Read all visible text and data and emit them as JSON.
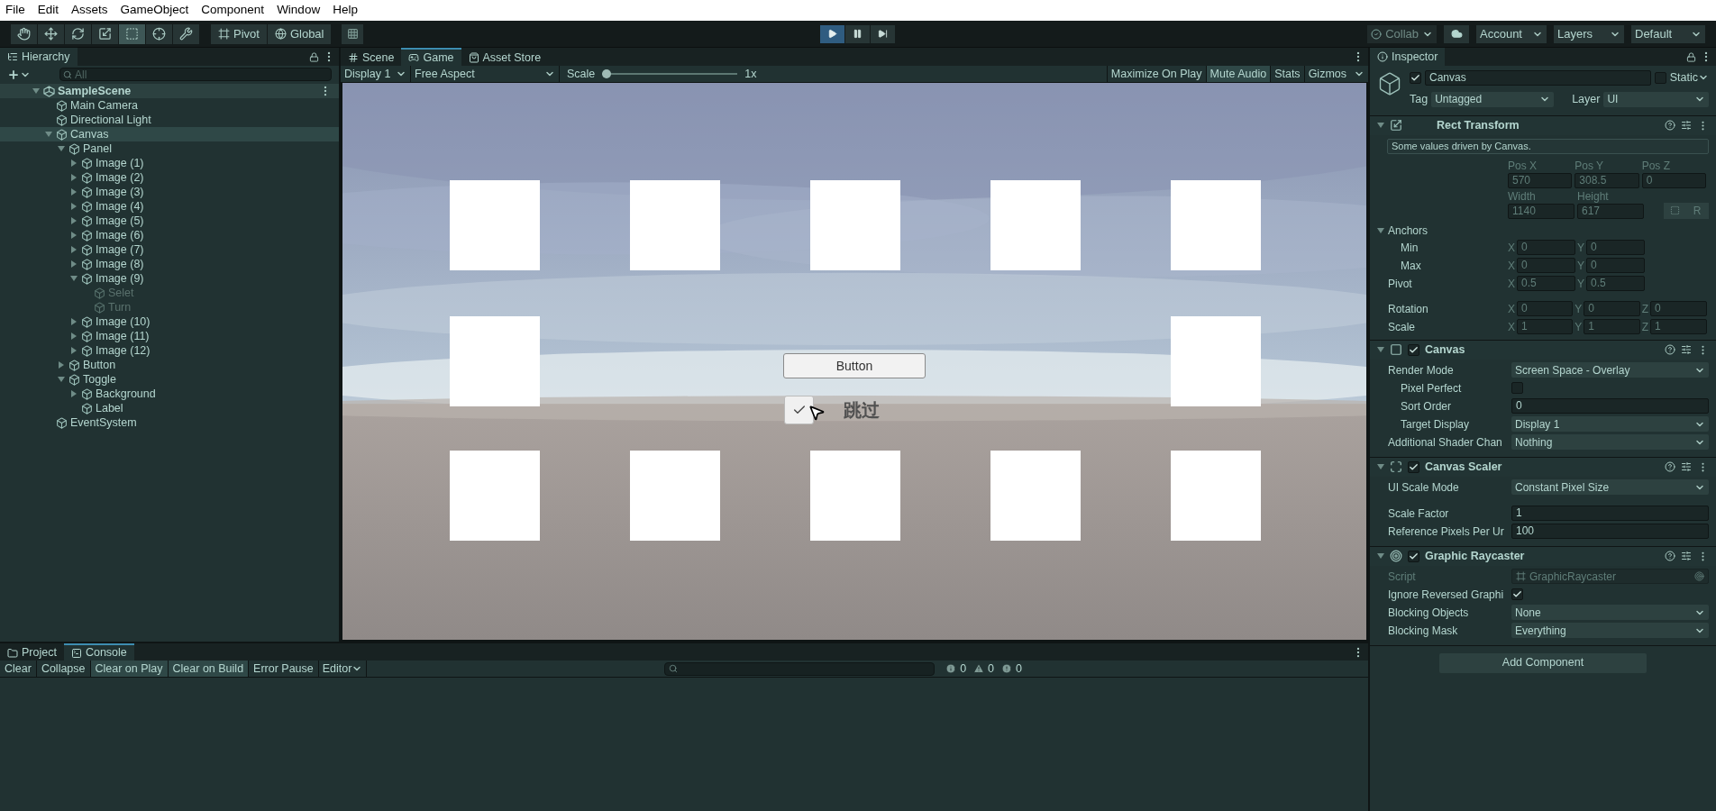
{
  "menu_bar": [
    "File",
    "Edit",
    "Assets",
    "GameObject",
    "Component",
    "Window",
    "Help"
  ],
  "toolbar": {
    "tools": [
      {
        "kind": "hand",
        "selected": false
      },
      {
        "kind": "move",
        "selected": false
      },
      {
        "kind": "rotate",
        "selected": false
      },
      {
        "kind": "scale",
        "selected": false
      },
      {
        "kind": "rect",
        "selected": true
      },
      {
        "kind": "transform",
        "selected": false
      },
      {
        "kind": "custom",
        "selected": false
      }
    ],
    "pivot": "Pivot",
    "global": "Global",
    "play": {
      "on": true
    },
    "collab": "Collab",
    "account": "Account",
    "layers": "Layers",
    "layout": "Default"
  },
  "hierarchy": {
    "tab": "Hierarchy",
    "search_placeholder": "All",
    "scene": {
      "name": "SampleScene",
      "expanded": true,
      "children": [
        {
          "name": "Main Camera",
          "active": true,
          "selected": false
        },
        {
          "name": "Directional Light",
          "active": true,
          "selected": false
        },
        {
          "name": "Canvas",
          "active": true,
          "selected": true,
          "expanded": true,
          "children": [
            {
              "name": "Panel",
              "active": true,
              "selected": false,
              "expanded": true,
              "children": [
                {
                  "name": "Image (1)",
                  "active": true,
                  "selected": false,
                  "expanded": false
                },
                {
                  "name": "Image (2)",
                  "active": true,
                  "selected": false,
                  "expanded": false
                },
                {
                  "name": "Image (3)",
                  "active": true,
                  "selected": false,
                  "expanded": false
                },
                {
                  "name": "Image (4)",
                  "active": true,
                  "selected": false,
                  "expanded": false
                },
                {
                  "name": "Image (5)",
                  "active": true,
                  "selected": false,
                  "expanded": false
                },
                {
                  "name": "Image (6)",
                  "active": true,
                  "selected": false,
                  "expanded": false
                },
                {
                  "name": "Image (7)",
                  "active": true,
                  "selected": false,
                  "expanded": false
                },
                {
                  "name": "Image (8)",
                  "active": true,
                  "selected": false,
                  "expanded": false
                },
                {
                  "name": "Image (9)",
                  "active": true,
                  "selected": false,
                  "expanded": true,
                  "children": [
                    {
                      "name": "Selet",
                      "active": false,
                      "selected": false
                    },
                    {
                      "name": "Turn",
                      "active": false,
                      "selected": false
                    }
                  ]
                },
                {
                  "name": "Image (10)",
                  "active": true,
                  "selected": false,
                  "expanded": false
                },
                {
                  "name": "Image (11)",
                  "active": true,
                  "selected": false,
                  "expanded": false
                },
                {
                  "name": "Image (12)",
                  "active": true,
                  "selected": false,
                  "expanded": false
                }
              ]
            },
            {
              "name": "Button",
              "active": true,
              "selected": false,
              "expanded": false
            },
            {
              "name": "Toggle",
              "active": true,
              "selected": false,
              "expanded": true,
              "children": [
                {
                  "name": "Background",
                  "active": true,
                  "selected": false,
                  "expanded": false
                },
                {
                  "name": "Label",
                  "active": true,
                  "selected": false
                }
              ]
            }
          ]
        },
        {
          "name": "EventSystem",
          "active": true,
          "selected": false
        }
      ]
    }
  },
  "game": {
    "tabs": [
      {
        "label": "Scene",
        "kind": "scene",
        "selected": false
      },
      {
        "label": "Game",
        "kind": "game",
        "selected": true
      },
      {
        "label": "Asset Store",
        "kind": "store",
        "selected": false
      }
    ],
    "display": "Display 1",
    "aspect": "Free Aspect",
    "scale_label": "Scale",
    "scale": {
      "level": 0
    },
    "scale_value": "1x",
    "options": [
      {
        "label": "Maximize On Play",
        "on": false
      },
      {
        "label": "Mute Audio",
        "on": true
      },
      {
        "label": "Stats",
        "on": false
      }
    ],
    "gizmos": "Gizmos",
    "button": "Button",
    "toggle": {
      "label": "跳过",
      "checked": true
    }
  },
  "inspector": {
    "tab": "Inspector",
    "object": {
      "name": "Canvas",
      "active": true,
      "static": false,
      "static_label": "Static",
      "tag_label": "Tag",
      "tag": "Untagged",
      "layer_label": "Layer",
      "layer": "UI"
    },
    "rect_transform": {
      "title": "Rect Transform",
      "expanded": true,
      "note": "Some values driven by Canvas.",
      "position": [
        {
          "label": "Pos X",
          "value": "570"
        },
        {
          "label": "Pos Y",
          "value": "308.5"
        },
        {
          "label": "Pos Z",
          "value": "0"
        }
      ],
      "size": [
        {
          "label": "Width",
          "value": "1140"
        },
        {
          "label": "Height",
          "value": "617"
        }
      ],
      "raw_button": "R",
      "anchors": {
        "label": "Anchors",
        "expanded": true,
        "children": [
          {
            "label": "Min",
            "fields": [
              {
                "axis": "X",
                "value": "0"
              },
              {
                "axis": "Y",
                "value": "0"
              }
            ]
          },
          {
            "label": "Max",
            "fields": [
              {
                "axis": "X",
                "value": "0"
              },
              {
                "axis": "Y",
                "value": "0"
              }
            ]
          }
        ]
      },
      "vectors": [
        {
          "label": "Pivot",
          "fields": [
            {
              "axis": "X",
              "value": "0.5"
            },
            {
              "axis": "Y",
              "value": "0.5"
            }
          ]
        },
        {
          "label": "Rotation",
          "fields": [
            {
              "axis": "X",
              "value": "0"
            },
            {
              "axis": "Y",
              "value": "0"
            },
            {
              "axis": "Z",
              "value": "0"
            }
          ]
        },
        {
          "label": "Scale",
          "fields": [
            {
              "axis": "X",
              "value": "1"
            },
            {
              "axis": "Y",
              "value": "1"
            },
            {
              "axis": "Z",
              "value": "1"
            }
          ]
        }
      ]
    },
    "components": [
      {
        "title": "Canvas",
        "kind": "canvas",
        "enabled": true,
        "expanded": true,
        "rows": [
          {
            "kind": "dropdown",
            "label": "Render Mode",
            "value": "Screen Space - Overlay",
            "children": [
              {
                "kind": "checkbox",
                "label": "Pixel Perfect",
                "checked": false
              },
              {
                "kind": "number",
                "label": "Sort Order",
                "value": "0"
              },
              {
                "kind": "dropdown",
                "label": "Target Display",
                "value": "Display 1"
              }
            ]
          },
          {
            "kind": "dropdown",
            "label": "Additional Shader Chan",
            "value": "Nothing"
          }
        ]
      },
      {
        "title": "Canvas Scaler",
        "kind": "scaler",
        "enabled": true,
        "expanded": true,
        "rows": [
          {
            "kind": "dropdown",
            "label": "UI Scale Mode",
            "value": "Constant Pixel Size"
          },
          {
            "kind": "gap"
          },
          {
            "kind": "number",
            "label": "Scale Factor",
            "value": "1"
          },
          {
            "kind": "number",
            "label": "Reference Pixels Per Ur",
            "value": "100"
          }
        ]
      },
      {
        "title": "Graphic Raycaster",
        "kind": "raycaster",
        "enabled": true,
        "expanded": true,
        "rows": [
          {
            "kind": "object",
            "label": "Script",
            "value": "GraphicRaycaster"
          },
          {
            "kind": "checkbox",
            "label": "Ignore Reversed Graphi",
            "checked": true
          },
          {
            "kind": "dropdown",
            "label": "Blocking Objects",
            "value": "None"
          },
          {
            "kind": "dropdown",
            "label": "Blocking Mask",
            "value": "Everything"
          }
        ]
      }
    ],
    "add_component": "Add Component"
  },
  "console": {
    "tabs": [
      {
        "label": "Project",
        "kind": "project",
        "selected": false
      },
      {
        "label": "Console",
        "kind": "console",
        "selected": true
      }
    ],
    "buttons": [
      {
        "label": "Clear",
        "on": false
      },
      {
        "label": "Collapse",
        "on": false
      },
      {
        "label": "Clear on Play",
        "on": true
      },
      {
        "label": "Clear on Build",
        "on": true
      },
      {
        "label": "Error Pause",
        "on": false
      }
    ],
    "filter": "Editor",
    "counts": [
      {
        "kind": "info",
        "value": "0"
      },
      {
        "kind": "warning",
        "value": "0"
      },
      {
        "kind": "error",
        "value": "0"
      }
    ]
  }
}
